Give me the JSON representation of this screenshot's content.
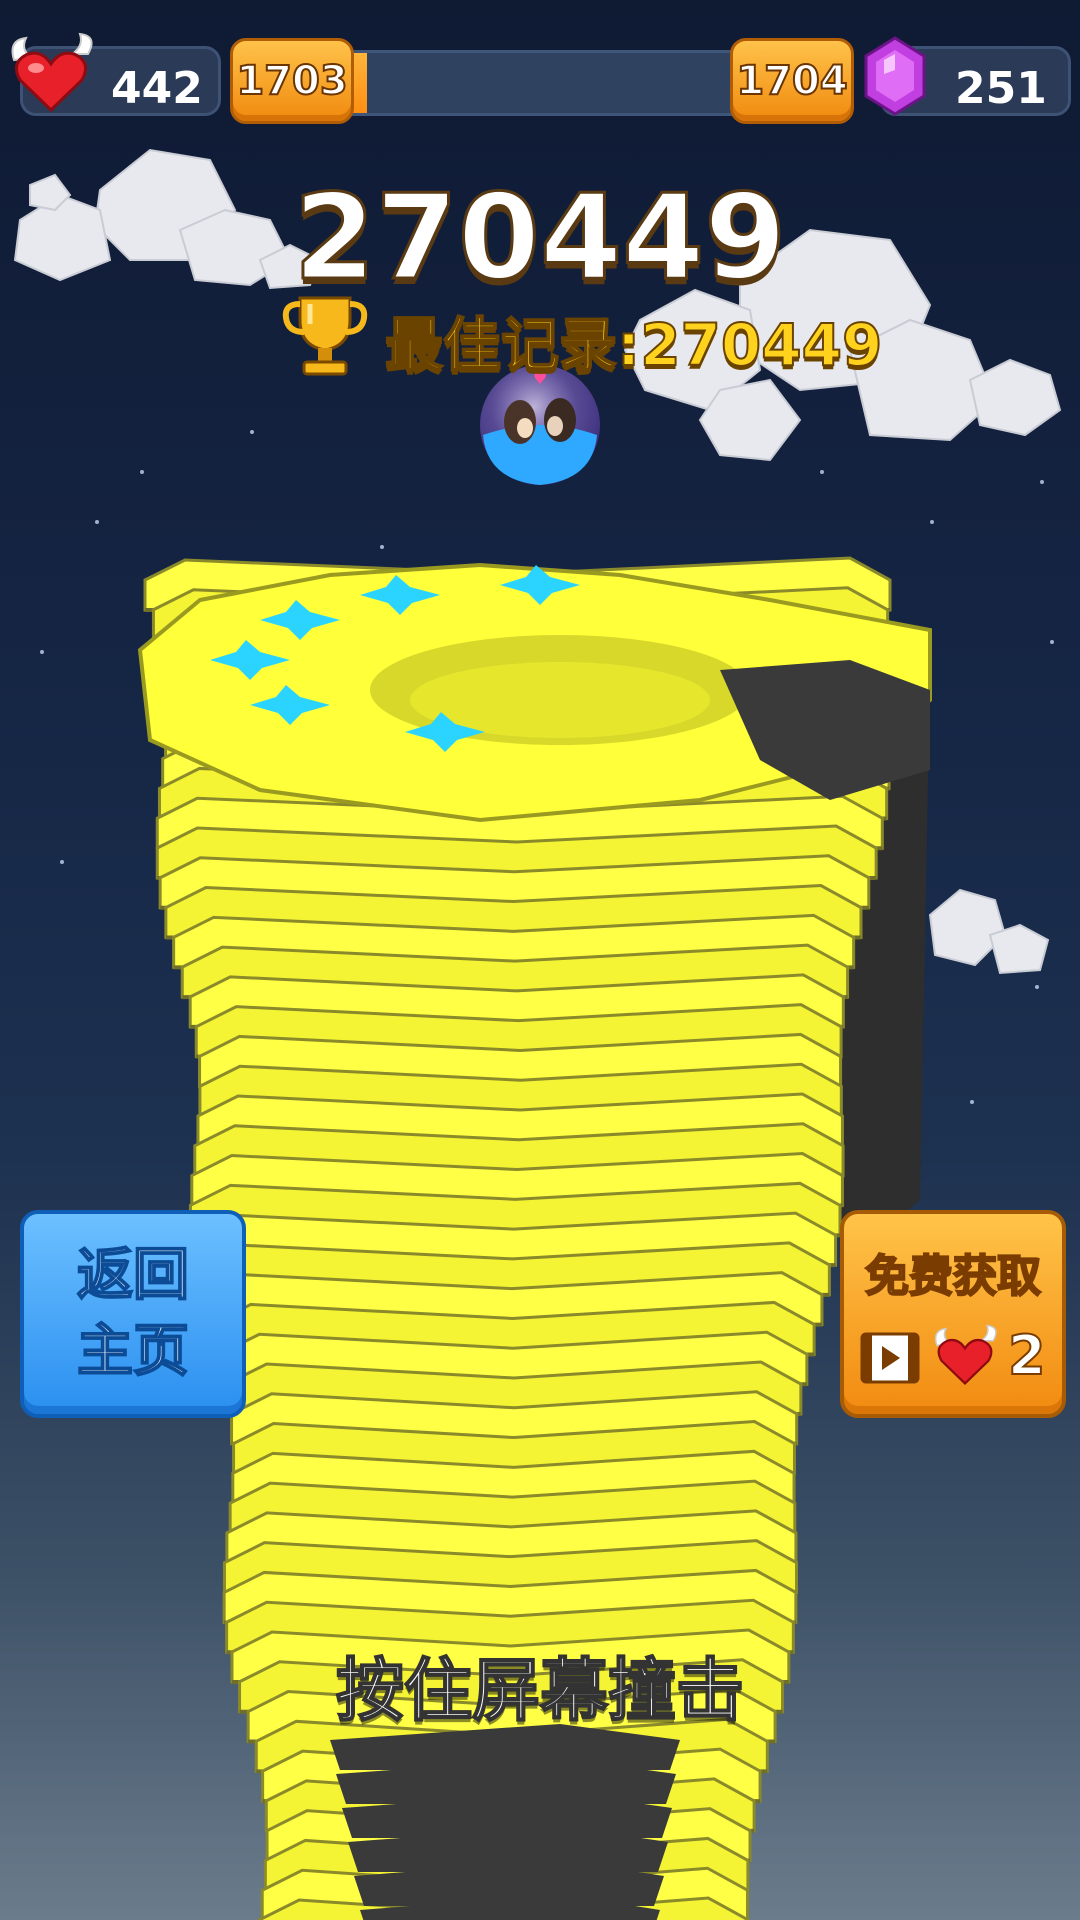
{
  "hud": {
    "lives": "442",
    "level_current": "1703",
    "level_next": "1704",
    "level_progress_fraction": 0.06,
    "gems": "251"
  },
  "score": {
    "current": "270449",
    "best_label": "最佳记录:270449"
  },
  "buttons": {
    "home_line1": "返回",
    "home_line2": "主页",
    "free_label": "免费获取",
    "free_count": "2"
  },
  "hint": "按住屏幕撞击",
  "colors": {
    "tower_yellow": "#ffff3a",
    "tower_dark": "#3a3a3a",
    "accent_orange": "#f59a16",
    "accent_blue": "#3aa0f6"
  },
  "icons": {
    "lives": "winged-heart-icon",
    "gems": "purple-gem-icon",
    "trophy": "trophy-icon",
    "video": "video-icon"
  }
}
